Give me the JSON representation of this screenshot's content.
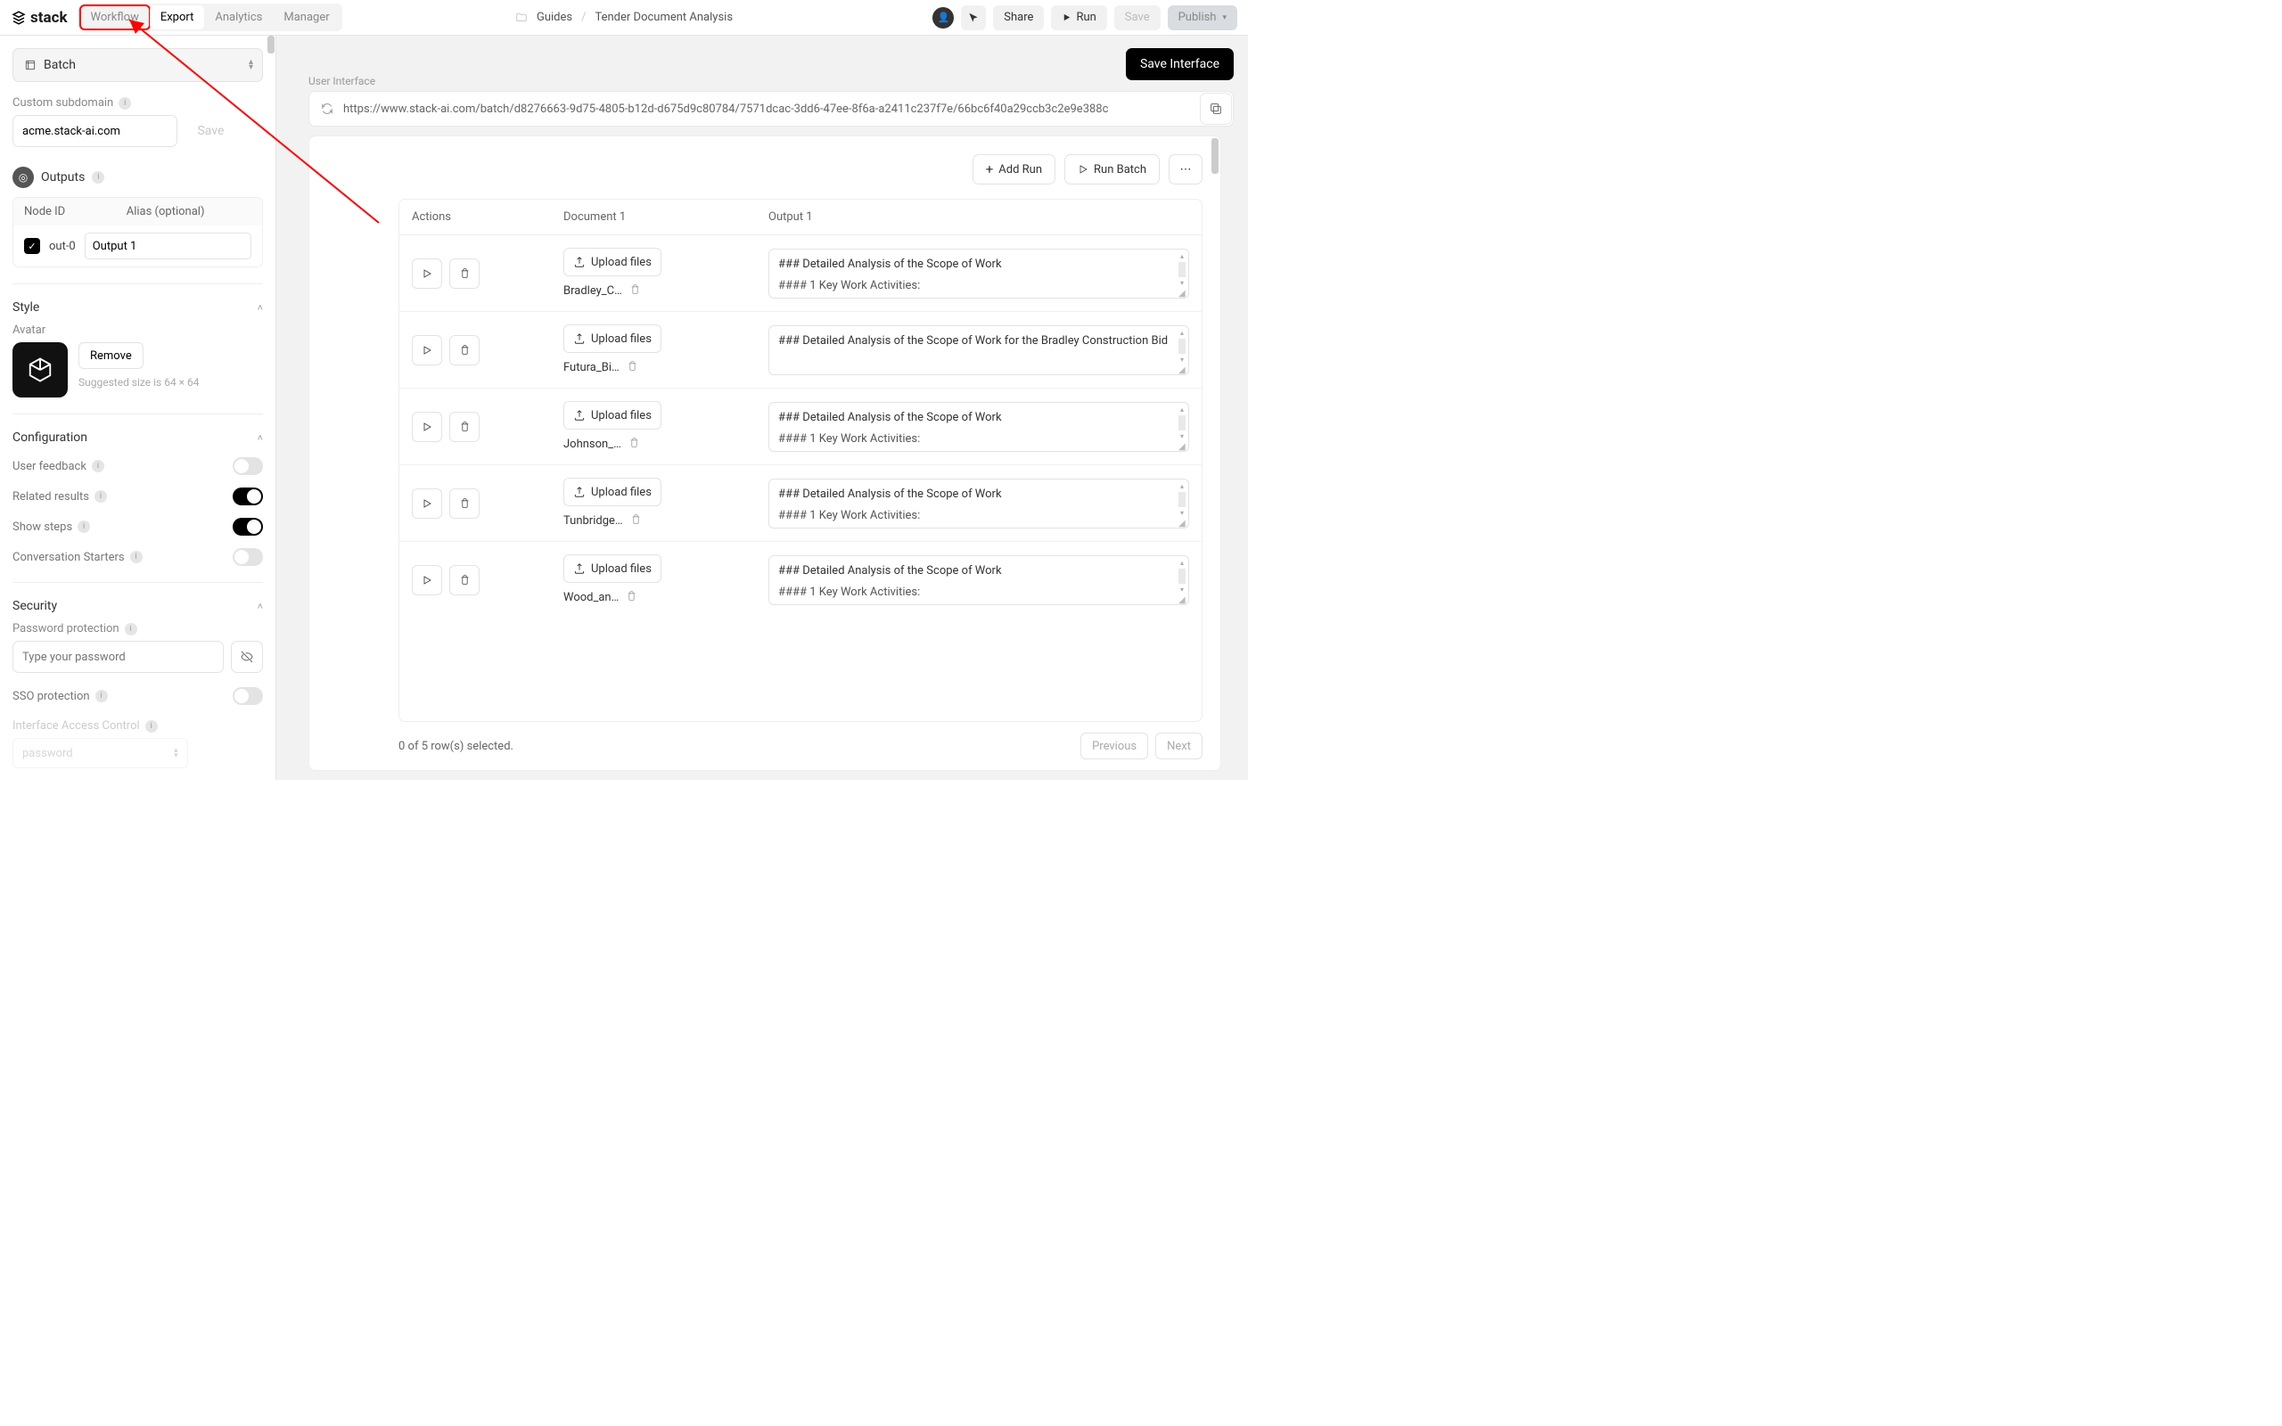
{
  "brand": "stack",
  "tabs": [
    "Workflow",
    "Export",
    "Analytics",
    "Manager"
  ],
  "breadcrumb": {
    "folder": "Guides",
    "page": "Tender Document Analysis"
  },
  "header_buttons": {
    "share": "Share",
    "run": "Run",
    "save": "Save",
    "publish": "Publish"
  },
  "sidebar": {
    "mode": "Batch",
    "subdomain_label": "Custom subdomain",
    "subdomain_value": "acme.stack-ai.com",
    "subdomain_save": "Save",
    "outputs_title": "Outputs",
    "outputs_cols": {
      "id": "Node ID",
      "alias": "Alias (optional)"
    },
    "outputs_row": {
      "id": "out-0",
      "alias": "Output 1"
    },
    "style_title": "Style",
    "avatar_label": "Avatar",
    "remove": "Remove",
    "avatar_hint": "Suggested size is 64 × 64",
    "config_title": "Configuration",
    "toggles": {
      "feedback": "User feedback",
      "related": "Related results",
      "steps": "Show steps",
      "starters": "Conversation Starters"
    },
    "security_title": "Security",
    "pw_label": "Password protection",
    "pw_placeholder": "Type your password",
    "sso_label": "SSO protection",
    "iac_label": "Interface Access Control",
    "iac_value": "password"
  },
  "main": {
    "save_interface": "Save Interface",
    "ui_label": "User Interface",
    "url": "https://www.stack-ai.com/batch/d8276663-9d75-4805-b12d-d675d9c80784/7571dcac-3dd6-47ee-8f6a-a2411c237f7e/66bc6f40a29ccb3c2e9e388c",
    "add_run": "Add Run",
    "run_batch": "Run Batch",
    "cols": {
      "actions": "Actions",
      "doc": "Document 1",
      "out": "Output 1"
    },
    "upload": "Upload files",
    "rows": [
      {
        "file": "Bradley_C…",
        "out1": "### Detailed Analysis of the Scope of Work",
        "out2": "#### 1  Key Work Activities:"
      },
      {
        "file": "Futura_Bi…",
        "out1": "### Detailed Analysis of the Scope of Work for the Bradley Construction Bid",
        "out2": ""
      },
      {
        "file": "Johnson_…",
        "out1": "### Detailed Analysis of the Scope of Work",
        "out2": "#### 1  Key Work Activities:"
      },
      {
        "file": "Tunbridge…",
        "out1": "### Detailed Analysis of the Scope of Work",
        "out2": "#### 1  Key Work Activities:"
      },
      {
        "file": "Wood_an…",
        "out1": "### Detailed Analysis of the Scope of Work",
        "out2": "#### 1  Key Work Activities:"
      }
    ],
    "footer": "0 of 5 row(s) selected.",
    "prev": "Previous",
    "next": "Next"
  }
}
